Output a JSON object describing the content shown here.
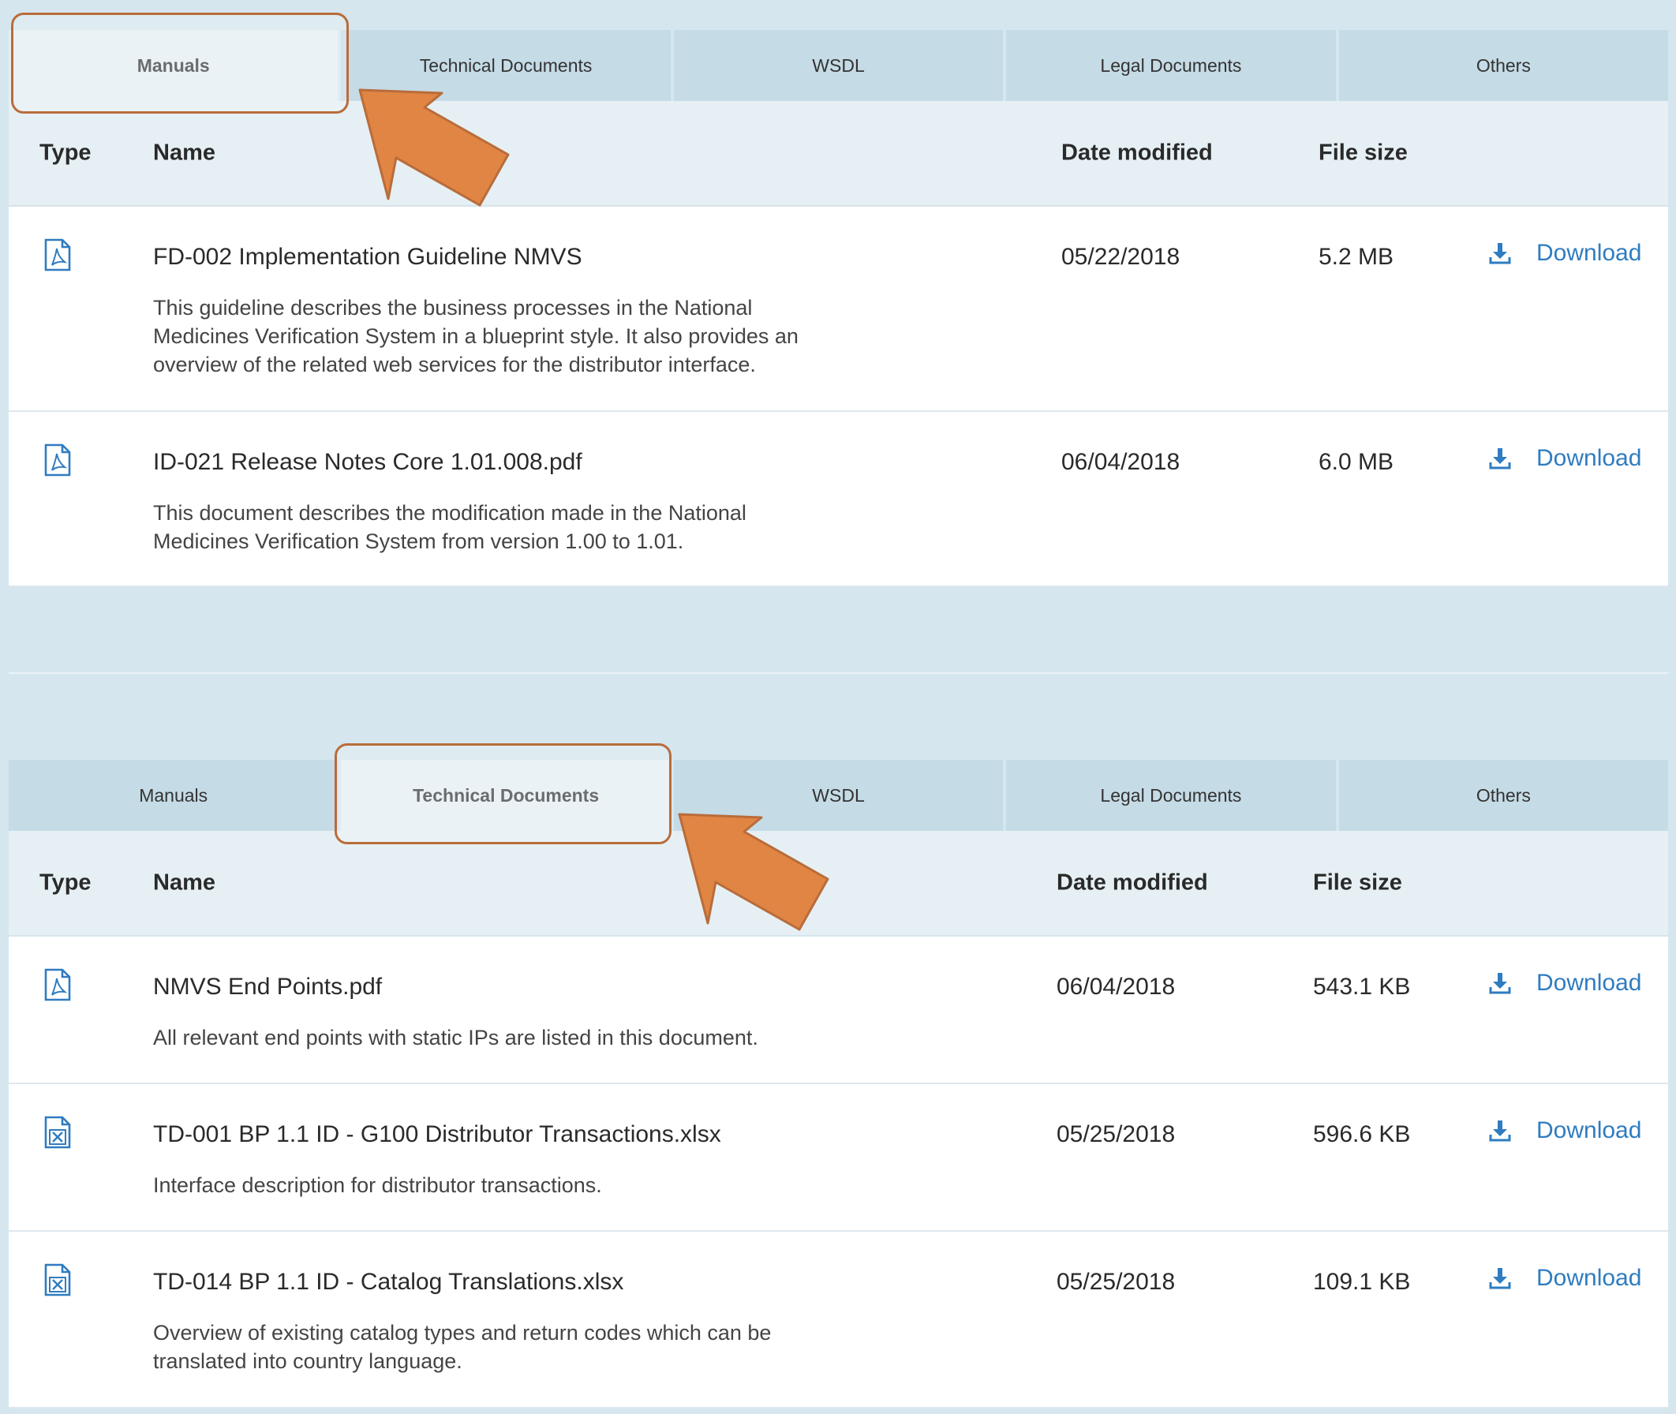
{
  "tabs": [
    "Manuals",
    "Technical Documents",
    "WSDL",
    "Legal Documents",
    "Others"
  ],
  "columns": {
    "type": "Type",
    "name": "Name",
    "date": "Date modified",
    "size": "File size"
  },
  "download_label": "Download",
  "colors": {
    "accent": "#2f7cc0",
    "highlight": "#b96c3a",
    "arrow": "#e08544"
  },
  "icons": {
    "pdf": "pdf-file-icon",
    "excel": "excel-file-icon",
    "download": "download-icon"
  },
  "panel1": {
    "active_tab": "Manuals",
    "rows": [
      {
        "name": "FD-002 Implementation Guideline NMVS",
        "description": "This guideline describes the business processes in the National\nMedicines Verification System in a blueprint style. It also provides an\noverview of the related web services for the distributor interface.",
        "date": "05/22/2018",
        "size": "5.2 MB"
      },
      {
        "name": "ID-021 Release Notes Core 1.01.008.pdf",
        "description": "This document describes the modification made in the National\nMedicines Verification System from version 1.00 to 1.01.",
        "date": "06/04/2018",
        "size": "6.0 MB"
      }
    ]
  },
  "panel2": {
    "active_tab": "Technical Documents",
    "rows": [
      {
        "name": "NMVS End Points.pdf",
        "description": "All relevant end points with static IPs are listed in this document.",
        "date": "06/04/2018",
        "size": "543.1 KB"
      },
      {
        "name": "TD-001 BP 1.1 ID - G100 Distributor Transactions.xlsx",
        "description": "Interface description for distributor transactions.",
        "date": "05/25/2018",
        "size": "596.6 KB"
      },
      {
        "name": "TD-014 BP 1.1 ID - Catalog Translations.xlsx",
        "description": "Overview of existing catalog types and return codes which can be\ntranslated into country language.",
        "date": "05/25/2018",
        "size": "109.1 KB"
      }
    ]
  }
}
